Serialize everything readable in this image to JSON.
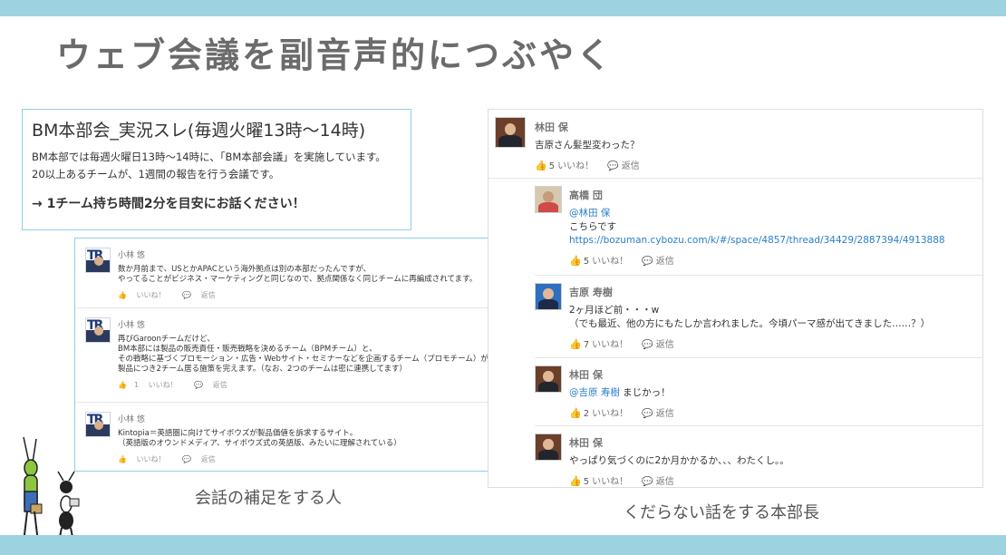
{
  "slide": {
    "title": "ウェブ会議を副音声的につぶやく"
  },
  "intro": {
    "title": "BM本部会_実況スレ(毎週火曜13時〜14時)",
    "desc_line1": "BM本部では毎週火曜日13時〜14時に、「BM本部会議」を実施しています。",
    "desc_line2": "20以上あるチームが、1週間の報告を行う会議です。",
    "cta": "→ 1チーム持ち時間2分を目安にお話ください！"
  },
  "left_thread": {
    "avatar_letters": "TR",
    "like_icon": "thumbs-up-icon",
    "reply_icon": "speech-bubble-icon",
    "posts": [
      {
        "author": "小林 悠",
        "lines": [
          "数か月前まで、USとかAPACという海外拠点は別の本部だったんですが、",
          "やってることがビジネス・マーケティングと同じなので、拠点関係なく同じチームに再編成されてます。"
        ],
        "likes": "",
        "like_label": "いいね！",
        "reply_label": "返信"
      },
      {
        "author": "小林 悠",
        "lines": [
          "再びGaroonチームだけど、",
          "BM本部には製品の販売責任・販売戦略を決めるチーム（BPMチーム）と、",
          "その戦略に基づくプロモーション・広告・Webサイト・セミナーなどを企画するチーム（プロモチーム）が",
          "製品につき2チーム居る施策を完えます。（なお、2つのチームは密に連携してます）"
        ],
        "likes": "1",
        "like_label": "いいね！",
        "reply_label": "返信"
      },
      {
        "author": "小林 悠",
        "lines": [
          "Kintopia＝英語圏に向けてサイボウズが製品価値を訴求するサイト。",
          "（英語版のオウンドメディア、サイボウズ式の英語版、みたいに理解されている）"
        ],
        "likes": "",
        "like_label": "いいね！",
        "reply_label": "返信"
      }
    ],
    "caption": "会話の補足をする人"
  },
  "right_thread": {
    "like_icon": "thumbs-up-icon",
    "reply_icon": "speech-bubble-icon",
    "top": {
      "author": "林田 保",
      "text": "吉原さん髪型変わった？",
      "likes": "5",
      "like_label": "いいね！",
      "reply_label": "返信"
    },
    "replies": [
      {
        "author": "高橋 団",
        "mention": "@林田 保",
        "lines": [
          "こちらです"
        ],
        "link": "https://bozuman.cybozu.com/k/#/space/4857/thread/34429/2887394/4913888",
        "likes": "5",
        "like_label": "いいね！",
        "reply_label": "返信"
      },
      {
        "author": "吉原 寿樹",
        "lines": [
          "2ヶ月ほど前・・・w",
          "（でも最近、他の方にもたしか言われました。今頃パーマ感が出てきました……？）"
        ],
        "likes": "7",
        "like_label": "いいね！",
        "reply_label": "返信"
      },
      {
        "author": "林田 保",
        "mention": "@吉原 寿樹",
        "text_after_mention": " まじかっ！",
        "likes": "2",
        "like_label": "いいね！",
        "reply_label": "返信"
      },
      {
        "author": "林田 保",
        "lines": [
          "やっぱり気づくのに2か月かかるか、、、わたくし。。"
        ],
        "likes": "5",
        "like_label": "いいね！",
        "reply_label": "返信"
      }
    ],
    "caption": "くだらない話をする本部長"
  },
  "colors": {
    "band": "#9dd3e1",
    "box_border": "#8fcfe6",
    "link": "#2a7fc9",
    "title": "#6b6b6b"
  }
}
